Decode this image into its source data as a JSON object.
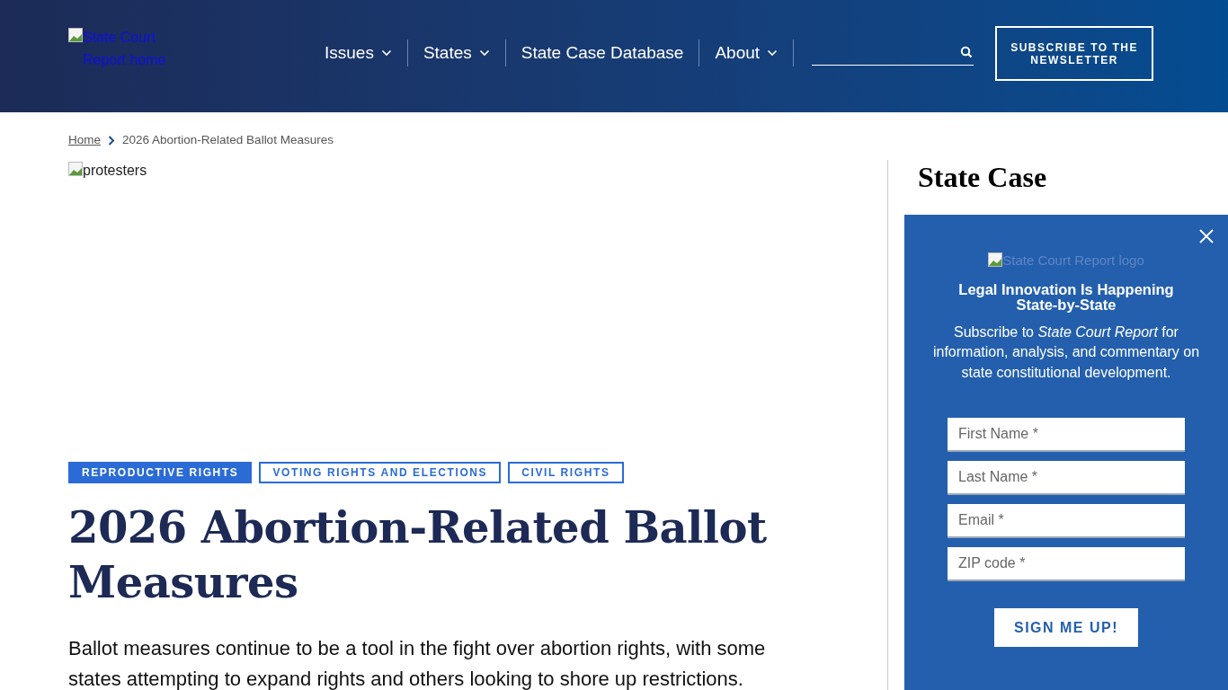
{
  "header": {
    "logo_alt": "State Court Report home",
    "nav": [
      {
        "label": "Issues",
        "dropdown": true
      },
      {
        "label": "States",
        "dropdown": true
      },
      {
        "label": "State Case Database",
        "dropdown": false
      },
      {
        "label": "About",
        "dropdown": true
      }
    ],
    "subscribe_button": "SUBSCRIBE TO THE NEWSLETTER"
  },
  "breadcrumb": [
    "Home",
    "2026 Abortion-Related Ballot Measures"
  ],
  "article": {
    "image_alt": "protesters",
    "tags": [
      {
        "label": "REPRODUCTIVE RIGHTS",
        "selected": true
      },
      {
        "label": "VOTING RIGHTS AND ELECTIONS",
        "selected": false
      },
      {
        "label": "CIVIL RIGHTS",
        "selected": false
      }
    ],
    "title": "2026 Abortion-Related Ballot Measures",
    "lead": "Ballot measures continue to be a tool in the fight over abortion rights, with some states attempting to expand rights and others looking to shore up restrictions."
  },
  "sidebar": {
    "heading": "State Case"
  },
  "popup": {
    "logo_alt": "State Court Report logo",
    "title": "Legal Innovation Is Happening State-by-State",
    "text": "Subscribe to *State Court Report* for information, analysis, and commentary on state constitutional development.",
    "fields": [
      {
        "placeholder": "First Name *"
      },
      {
        "placeholder": "Last Name *"
      },
      {
        "placeholder": "Email *"
      },
      {
        "placeholder": "ZIP code *"
      }
    ],
    "button": "SIGN ME UP!"
  }
}
